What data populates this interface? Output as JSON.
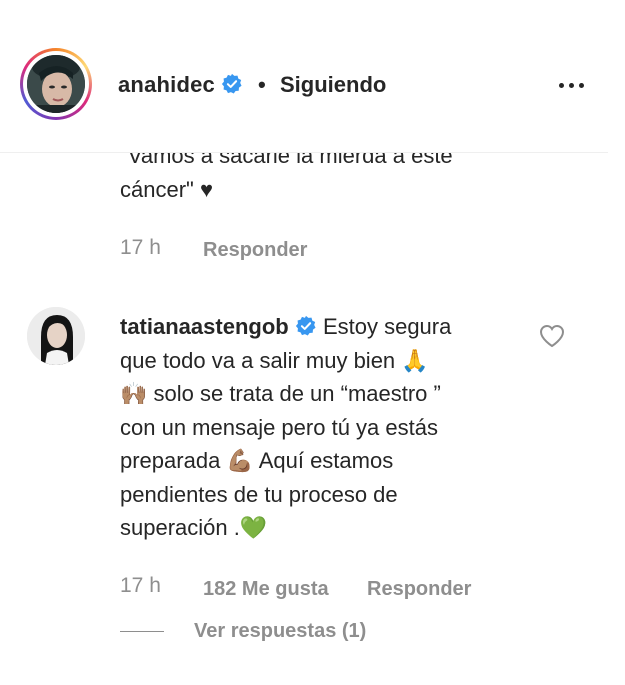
{
  "header": {
    "username": "anahidec",
    "separator": "•",
    "follow_status": "Siguiendo"
  },
  "comment1": {
    "text_line1": "\"Vamos a sacarle la mierda a este",
    "text_line2": "cáncer\" ♥",
    "time": "17 h",
    "reply_label": "Responder"
  },
  "comment2": {
    "username": "tatianaastengob",
    "line1": "Estoy segura",
    "line2": "que todo va a salir muy bien 🙏",
    "line3": "🙌🏽 solo se trata de un “maestro ”",
    "line4": "con un mensaje pero tú ya estás",
    "line5": "preparada 💪🏽 Aquí estamos",
    "line6": "pendientes de tu proceso de",
    "line7": "superación .💚",
    "time": "17 h",
    "likes": "182 Me gusta",
    "reply_label": "Responder",
    "view_replies": "Ver respuestas (1)"
  },
  "colors": {
    "text": "#262626",
    "muted": "#8e8e8e",
    "verified": "#3897f0",
    "heart_green": "#4cd137"
  },
  "icons": [
    "verified-badge-icon",
    "more-options-icon",
    "like-heart-icon"
  ]
}
